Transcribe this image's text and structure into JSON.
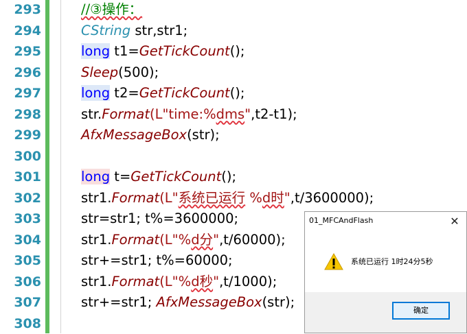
{
  "editor": {
    "lines": [
      {
        "num": "293",
        "tokens": [
          {
            "t": "//③操作：",
            "c": "cm squig"
          }
        ]
      },
      {
        "num": "294",
        "tokens": [
          {
            "t": "CString",
            "c": "cls"
          },
          {
            "t": " str,str1;",
            "c": ""
          }
        ]
      },
      {
        "num": "295",
        "tokens": [
          {
            "t": "long",
            "c": "kw hl-blue"
          },
          {
            "t": " t1=",
            "c": ""
          },
          {
            "t": "GetTickCount",
            "c": "fn"
          },
          {
            "t": "();",
            "c": ""
          }
        ]
      },
      {
        "num": "296",
        "tokens": [
          {
            "t": "Sleep",
            "c": "fn"
          },
          {
            "t": "(500);",
            "c": ""
          }
        ]
      },
      {
        "num": "297",
        "tokens": [
          {
            "t": "long",
            "c": "kw hl-blue"
          },
          {
            "t": " t2=",
            "c": ""
          },
          {
            "t": "GetTickCount",
            "c": "fn"
          },
          {
            "t": "();",
            "c": ""
          }
        ]
      },
      {
        "num": "298",
        "tokens": [
          {
            "t": "str.",
            "c": ""
          },
          {
            "t": "Format",
            "c": "fn"
          },
          {
            "t": "(L\"time:%",
            "c": "str"
          },
          {
            "t": "dms",
            "c": "str squig"
          },
          {
            "t": "\"",
            "c": "str"
          },
          {
            "t": ",t2-t1);",
            "c": ""
          }
        ]
      },
      {
        "num": "299",
        "tokens": [
          {
            "t": "AfxMessageBox",
            "c": "fn"
          },
          {
            "t": "(str);",
            "c": ""
          }
        ]
      },
      {
        "num": "300",
        "tokens": []
      },
      {
        "num": "301",
        "tokens": [
          {
            "t": "long",
            "c": "kw hl-red"
          },
          {
            "t": " t=",
            "c": ""
          },
          {
            "t": "GetTickCount",
            "c": "fn"
          },
          {
            "t": "();",
            "c": ""
          }
        ]
      },
      {
        "num": "302",
        "tokens": [
          {
            "t": "str1.",
            "c": ""
          },
          {
            "t": "Format",
            "c": "fn"
          },
          {
            "t": "(L\"",
            "c": "str"
          },
          {
            "t": "系统已运行",
            "c": "str squig"
          },
          {
            "t": " %",
            "c": "str"
          },
          {
            "t": "d时",
            "c": "str squig"
          },
          {
            "t": "\"",
            "c": "str"
          },
          {
            "t": ",t/3600000);",
            "c": ""
          }
        ]
      },
      {
        "num": "303",
        "tokens": [
          {
            "t": "str=str1; t%=3600000;",
            "c": ""
          }
        ]
      },
      {
        "num": "304",
        "tokens": [
          {
            "t": "str1.",
            "c": ""
          },
          {
            "t": "Format",
            "c": "fn"
          },
          {
            "t": "(L\"%",
            "c": "str"
          },
          {
            "t": "d分",
            "c": "str squig"
          },
          {
            "t": "\"",
            "c": "str"
          },
          {
            "t": ",t/60000);",
            "c": ""
          }
        ]
      },
      {
        "num": "305",
        "tokens": [
          {
            "t": "str+=str1; t%=60000;",
            "c": ""
          }
        ]
      },
      {
        "num": "306",
        "tokens": [
          {
            "t": "str1.",
            "c": ""
          },
          {
            "t": "Format",
            "c": "fn"
          },
          {
            "t": "(L\"%",
            "c": "str"
          },
          {
            "t": "d秒",
            "c": "str squig"
          },
          {
            "t": "\"",
            "c": "str"
          },
          {
            "t": ",t/1000);",
            "c": ""
          }
        ]
      },
      {
        "num": "307",
        "tokens": [
          {
            "t": "str+=str1; ",
            "c": ""
          },
          {
            "t": "AfxMessageBox",
            "c": "fn"
          },
          {
            "t": "(str);",
            "c": ""
          }
        ]
      },
      {
        "num": "308",
        "tokens": []
      }
    ]
  },
  "dialog": {
    "title": "01_MFCAndFlash",
    "close_glyph": "✕",
    "message": "系统已运行 1时24分5秒",
    "ok_label": "确定",
    "icon": "warning-icon"
  },
  "colors": {
    "keyword": "#0000ff",
    "function": "#880000",
    "class": "#2b91af",
    "comment": "#008000",
    "string": "#a31515",
    "line_number": "#2b91af",
    "change_bar": "#5dbb5d"
  }
}
